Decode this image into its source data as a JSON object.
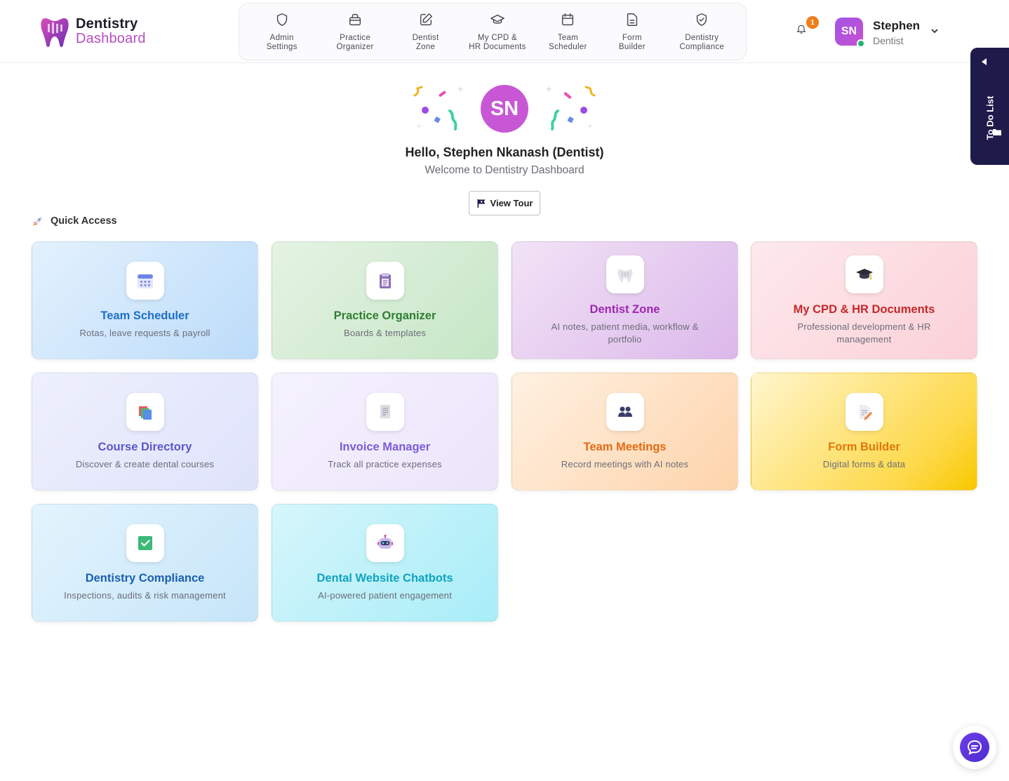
{
  "brand": {
    "line1": "Dentistry",
    "line2": "Dashboard",
    "accent": "#b64ec0"
  },
  "topnav": [
    {
      "label": "Admin\nSettings",
      "icon": "shield-icon"
    },
    {
      "label": "Practice\nOrganizer",
      "icon": "briefcase-icon"
    },
    {
      "label": "Dentist\nZone",
      "icon": "edit-icon"
    },
    {
      "label": "My CPD &\nHR Documents",
      "icon": "graduation-cap-icon"
    },
    {
      "label": "Team\nScheduler",
      "icon": "calendar-icon"
    },
    {
      "label": "Form\nBuilder",
      "icon": "document-icon"
    },
    {
      "label": "Dentistry\nCompliance",
      "icon": "shield-check-icon"
    }
  ],
  "notifications": {
    "count": "1"
  },
  "user": {
    "initials": "SN",
    "name": "Stephen",
    "role": "Dentist"
  },
  "todo": {
    "label": "To Do List"
  },
  "welcome": {
    "initials": "SN",
    "greeting": "Hello, Stephen Nkanash (Dentist)",
    "subtitle": "Welcome to Dentistry Dashboard",
    "tour_button": "View Tour"
  },
  "quick_access": {
    "title": "Quick Access",
    "cards": [
      {
        "title": "Team Scheduler",
        "desc": "Rotas, leave requests & payroll",
        "icon": "calendar-icon",
        "title_color": "#1e6fc7"
      },
      {
        "title": "Practice Organizer",
        "desc": "Boards & templates",
        "icon": "clipboard-icon",
        "title_color": "#2f7d32"
      },
      {
        "title": "Dentist Zone",
        "desc": "AI notes, patient media, workflow & portfolio",
        "icon": "tooth-icon",
        "title_color": "#9c27b0"
      },
      {
        "title": "My CPD & HR Documents",
        "desc": "Professional development & HR management",
        "icon": "graduation-cap-icon",
        "title_color": "#c62828"
      },
      {
        "title": "Course Directory",
        "desc": "Discover & create dental courses",
        "icon": "books-icon",
        "title_color": "#5b57c8"
      },
      {
        "title": "Invoice Manager",
        "desc": "Track all practice expenses",
        "icon": "receipt-icon",
        "title_color": "#7b5cd6"
      },
      {
        "title": "Team Meetings",
        "desc": "Record meetings with AI notes",
        "icon": "people-icon",
        "title_color": "#e56a12"
      },
      {
        "title": "Form Builder",
        "desc": "Digital forms & data",
        "icon": "form-pencil-icon",
        "title_color": "#e0780a"
      },
      {
        "title": "Dentistry Compliance",
        "desc": "Inspections, audits & risk management",
        "icon": "checkbox-icon",
        "title_color": "#1b5fb0"
      },
      {
        "title": "Dental Website Chatbots",
        "desc": "AI-powered patient engagement",
        "icon": "robot-icon",
        "title_color": "#0fa3c0"
      }
    ]
  },
  "chat_widget": {
    "icon": "chat-bubble-icon"
  }
}
